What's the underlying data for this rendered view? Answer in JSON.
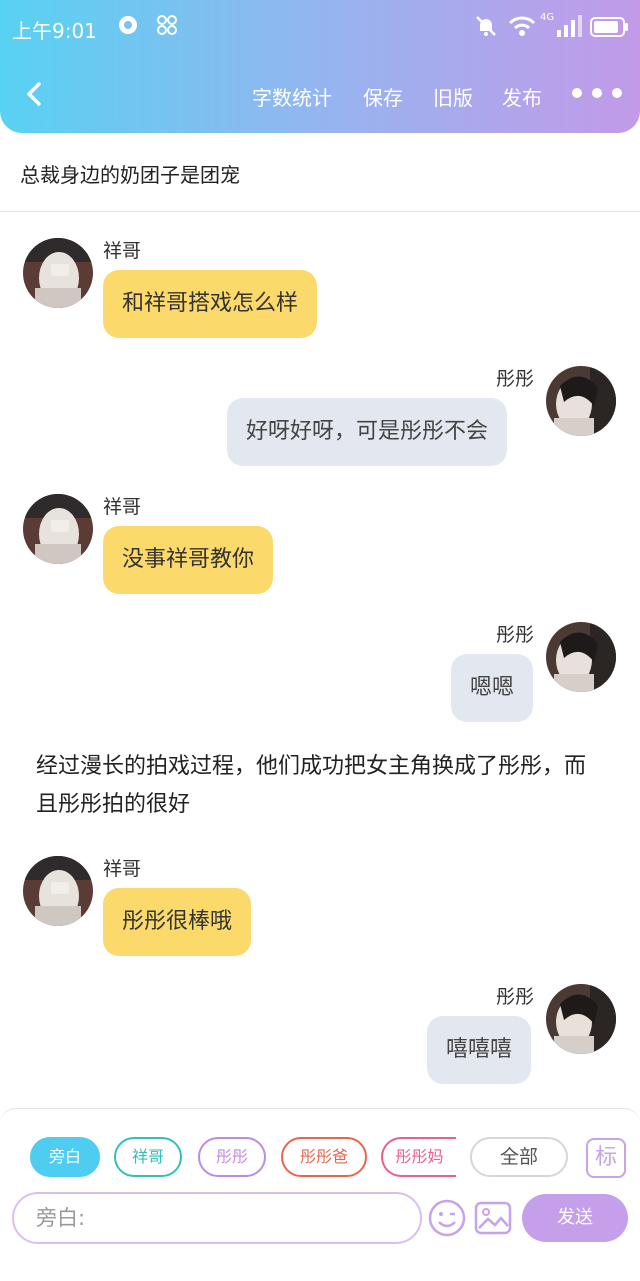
{
  "status": {
    "time": "上午9:01",
    "network": "4G"
  },
  "toolbar": {
    "back_icon": "chevron-left-icon",
    "items": [
      "字数统计",
      "保存",
      "旧版",
      "发布"
    ],
    "more_icon": "more-dots-icon"
  },
  "story_title": "总裁身边的奶团子是团宠",
  "messages": [
    {
      "side": "left",
      "name": "祥哥",
      "text": "和祥哥搭戏怎么样"
    },
    {
      "side": "right",
      "name": "彤彤",
      "text": "好呀好呀，可是彤彤不会"
    },
    {
      "side": "left",
      "name": "祥哥",
      "text": "没事祥哥教你"
    },
    {
      "side": "right",
      "name": "彤彤",
      "text": "嗯嗯"
    }
  ],
  "narration": "经过漫长的拍戏过程，他们成功把女主角换成了彤彤，而且彤彤拍的很好",
  "messages2": [
    {
      "side": "left",
      "name": "祥哥",
      "text": "彤彤很棒哦"
    },
    {
      "side": "right",
      "name": "彤彤",
      "text": "嘻嘻嘻"
    }
  ],
  "roles": [
    "旁白",
    "祥哥",
    "彤彤",
    "彤彤爸",
    "彤彤妈",
    "全部"
  ],
  "role_colors": {
    "narrator": "#4fcdf0",
    "xiangge": "#32c0b8",
    "tongtong": "#c18ae0",
    "dad": "#e9664c",
    "mom": "#ea5f92",
    "all": "#d0d0d0"
  },
  "label_button": "标",
  "input": {
    "placeholder": "旁白:"
  },
  "send_button": "发送",
  "accent_colors": {
    "header_start": "#58d2f2",
    "header_end": "#c29ae8",
    "left_bubble": "#fbd96b",
    "right_bubble": "#e3e7ef"
  }
}
